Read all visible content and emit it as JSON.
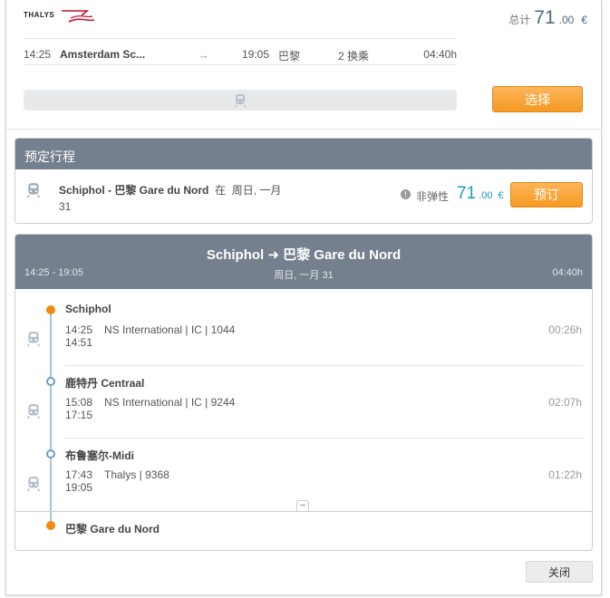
{
  "brand": {
    "name": "THALYS"
  },
  "total": {
    "label": "总计",
    "int": "71",
    "dec": ".00",
    "currency": "€"
  },
  "summary": {
    "departure": "14:25",
    "origin": "Amsterdam Sc...",
    "arrival": "19:05",
    "destination": "巴黎",
    "changes": "2 换乘",
    "duration": "04:40h"
  },
  "buttons": {
    "select": "选择",
    "book": "预订",
    "close": "关闭"
  },
  "booking": {
    "title": "预定行程",
    "route": "Schiphol - 巴黎 Gare du Nord",
    "on": "在",
    "date_line1": "周日, 一月",
    "date_line2": "31",
    "fare_type": "非弹性",
    "price": {
      "int": "71",
      "dec": ".00",
      "currency": "€"
    }
  },
  "itinerary": {
    "from": "Schiphol",
    "arrow": "➜",
    "to": "巴黎 Gare du Nord",
    "time_range": "14:25 - 19:05",
    "date": "周日, 一月 31",
    "duration": "04:40h",
    "stops": [
      {
        "name": "Schiphol",
        "dep": "14:25",
        "arr": "14:51",
        "operator": "NS International | IC | 1044",
        "duration": "00:26h"
      },
      {
        "name": "鹿特丹 Centraal",
        "dep": "15:08",
        "arr": "17:15",
        "operator": "NS International | IC | 9244",
        "duration": "02:07h"
      },
      {
        "name": "布鲁塞尔-Midi",
        "dep": "17:43",
        "arr": "19:05",
        "operator": "Thalys | 9368",
        "duration": "01:22h"
      }
    ],
    "final_stop": "巴黎 Gare du Nord"
  },
  "colors": {
    "header": "#75808f",
    "accent_orange": "#f59a23",
    "price_blue": "#1a9bc3",
    "total_blue": "#4f6a7e"
  }
}
